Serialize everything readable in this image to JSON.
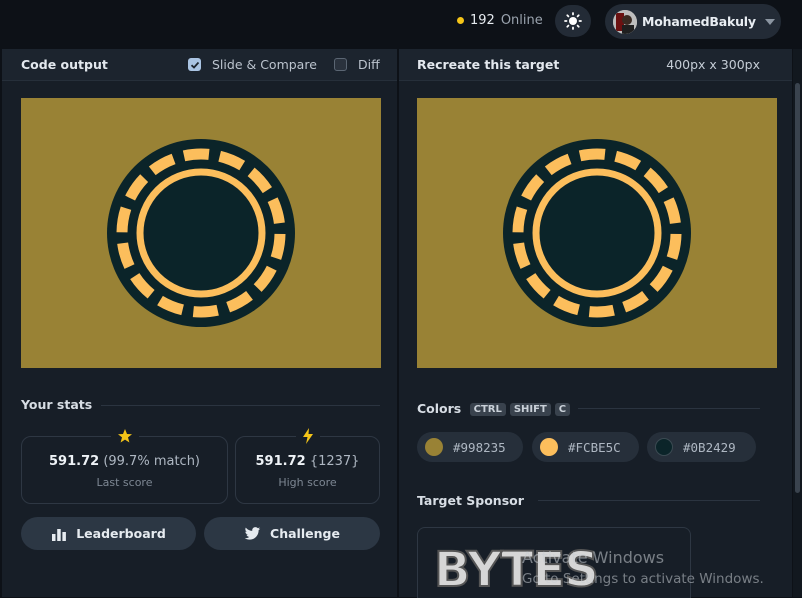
{
  "header": {
    "online_count": "192",
    "online_label": "Online",
    "username": "MohamedBakuly"
  },
  "left_panel": {
    "title": "Code output",
    "slide_compare_label": "Slide & Compare",
    "slide_compare_checked": true,
    "diff_label": "Diff",
    "diff_checked": false
  },
  "right_panel": {
    "title": "Recreate this target",
    "size_label": "400px x 300px"
  },
  "target": {
    "background": "#998235",
    "accent": "#FCBE5C",
    "dark": "#0B2429"
  },
  "stats": {
    "title": "Your stats",
    "last_score_value": "591.72",
    "last_score_match": "(99.7% match)",
    "last_score_label": "Last score",
    "high_score_value": "591.72",
    "high_score_count": "{1237}",
    "high_score_label": "High score"
  },
  "buttons": {
    "leaderboard": "Leaderboard",
    "challenge": "Challenge"
  },
  "colors": {
    "title": "Colors",
    "keys": [
      "CTRL",
      "SHIFT",
      "C"
    ],
    "swatches": [
      {
        "hex": "#998235"
      },
      {
        "hex": "#FCBE5C"
      },
      {
        "hex": "#0B2429"
      }
    ]
  },
  "sponsor": {
    "title": "Target Sponsor",
    "logo_text": "BYTES"
  },
  "os_watermark": {
    "line1": "Activate Windows",
    "line2": "Go to Settings to activate Windows."
  }
}
